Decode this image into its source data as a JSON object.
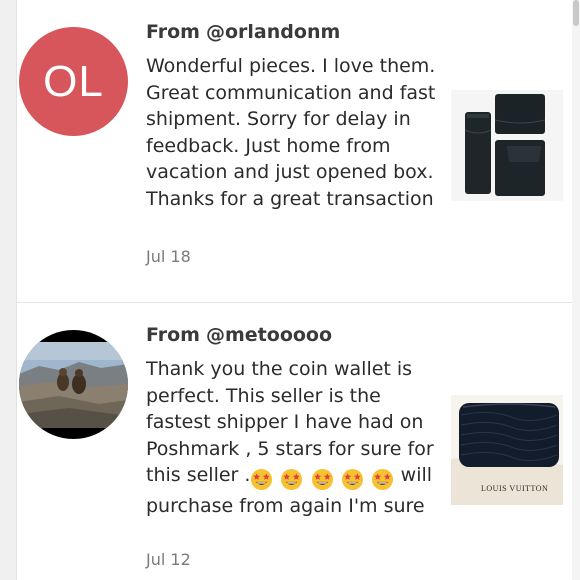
{
  "reviews": [
    {
      "from_label": "From",
      "username": "@orlandonm",
      "avatar_initials": "OL",
      "avatar_color": "#d6565c",
      "comment": "Wonderful pieces. I love them. Great communication and fast shipment. Sorry for delay in feedback. Just home from vacation and just opened box. Thanks for a great transaction",
      "date": "Jul 18",
      "product_thumbnail": "black-leather-wallets-photo"
    },
    {
      "from_label": "From",
      "username": "@metooooo",
      "avatar": "desert-landscape-photo",
      "comment_before_emoji": "Thank you the coin wallet is perfect. This seller is the fastest shipper I have had on Poshmark , 5 stars for sure for this seller .",
      "emoji": [
        "star-struck-emoji",
        "star-struck-emoji",
        "star-struck-emoji",
        "star-struck-emoji",
        "star-struck-emoji"
      ],
      "comment_after_emoji": " will purchase from again I'm sure",
      "date": "Jul 12",
      "product_thumbnail": "black-epi-coin-wallet-photo",
      "thumbnail_caption": "LOUIS VUITTON"
    }
  ],
  "colors": {
    "text": "#2b2b2b",
    "date": "#7a7a7a",
    "divider": "#e6e6e6"
  }
}
